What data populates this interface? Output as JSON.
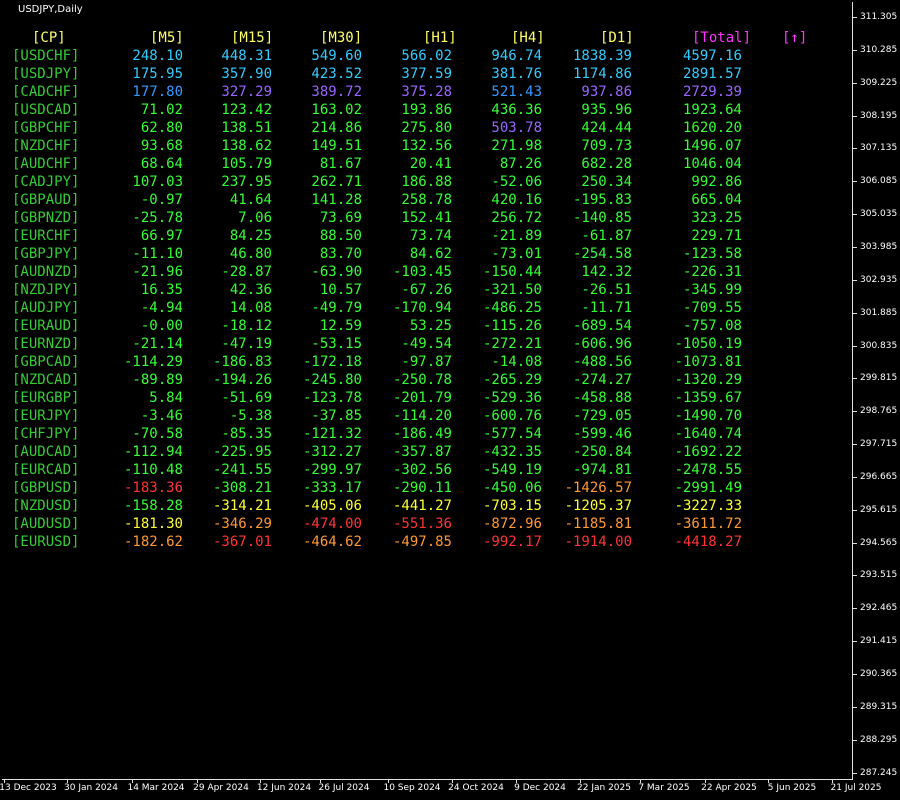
{
  "window": {
    "title": "USDJPY,Daily"
  },
  "price_axis": [
    "311.305",
    "310.285",
    "309.225",
    "308.195",
    "307.135",
    "306.085",
    "305.035",
    "303.985",
    "302.935",
    "301.885",
    "300.835",
    "299.815",
    "298.765",
    "297.715",
    "296.665",
    "295.615",
    "294.565",
    "293.515",
    "292.465",
    "291.415",
    "290.365",
    "289.315",
    "288.295",
    "287.245"
  ],
  "date_axis": [
    "13 Dec 2023",
    "30 Jan 2024",
    "14 Mar 2024",
    "29 Apr 2024",
    "12 Jun 2024",
    "26 Jul 2024",
    "10 Sep 2024",
    "24 Oct 2024",
    "9 Dec 2024",
    "22 Jan 2025",
    "7 Mar 2025",
    "22 Apr 2025",
    "5 Jun 2025",
    "21 Jul 2025"
  ],
  "colors": {
    "background": "#000000",
    "header_yellow": "#FFFF66",
    "header_magenta": "#FF33FF",
    "pair_green": "#32CD32",
    "cyan": "#33CCFF",
    "blue": "#3399FF",
    "purple": "#9966FF",
    "green": "#33FF33",
    "yellow": "#FFFF33",
    "orange": "#FF9933",
    "red": "#FF3333"
  },
  "table": {
    "headers": [
      "[CP]",
      "[M5]",
      "[M15]",
      "[M30]",
      "[H1]",
      "[H4]",
      "[D1]",
      "[Total]",
      "[↑]"
    ],
    "rows": [
      {
        "pair": "[USDCHF]",
        "values": [
          "248.10",
          "448.31",
          "549.60",
          "566.02",
          "946.74",
          "1838.39",
          "4597.16"
        ],
        "colors": [
          "cyan",
          "cyan",
          "cyan",
          "cyan",
          "cyan",
          "cyan",
          "cyan"
        ]
      },
      {
        "pair": "[USDJPY]",
        "values": [
          "175.95",
          "357.90",
          "423.52",
          "377.59",
          "381.76",
          "1174.86",
          "2891.57"
        ],
        "colors": [
          "cyan",
          "cyan",
          "cyan",
          "cyan",
          "cyan",
          "cyan",
          "cyan"
        ]
      },
      {
        "pair": "[CADCHF]",
        "values": [
          "177.80",
          "327.29",
          "389.72",
          "375.28",
          "521.43",
          "937.86",
          "2729.39"
        ],
        "colors": [
          "blue",
          "purple",
          "purple",
          "purple",
          "blue",
          "purple",
          "purple"
        ]
      },
      {
        "pair": "[USDCAD]",
        "values": [
          "71.02",
          "123.42",
          "163.02",
          "193.86",
          "436.36",
          "935.96",
          "1923.64"
        ],
        "colors": [
          "green",
          "green",
          "green",
          "green",
          "green",
          "green",
          "green"
        ]
      },
      {
        "pair": "[GBPCHF]",
        "values": [
          "62.80",
          "138.51",
          "214.86",
          "275.80",
          "503.78",
          "424.44",
          "1620.20"
        ],
        "colors": [
          "green",
          "green",
          "green",
          "green",
          "purple",
          "green",
          "green"
        ]
      },
      {
        "pair": "[NZDCHF]",
        "values": [
          "93.68",
          "138.62",
          "149.51",
          "132.56",
          "271.98",
          "709.73",
          "1496.07"
        ],
        "colors": [
          "green",
          "green",
          "green",
          "green",
          "green",
          "green",
          "green"
        ]
      },
      {
        "pair": "[AUDCHF]",
        "values": [
          "68.64",
          "105.79",
          "81.67",
          "20.41",
          "87.26",
          "682.28",
          "1046.04"
        ],
        "colors": [
          "green",
          "green",
          "green",
          "green",
          "green",
          "green",
          "green"
        ]
      },
      {
        "pair": "[CADJPY]",
        "values": [
          "107.03",
          "237.95",
          "262.71",
          "186.88",
          "-52.06",
          "250.34",
          "992.86"
        ],
        "colors": [
          "green",
          "green",
          "green",
          "green",
          "green",
          "green",
          "green"
        ]
      },
      {
        "pair": "[GBPAUD]",
        "values": [
          "-0.97",
          "41.64",
          "141.28",
          "258.78",
          "420.16",
          "-195.83",
          "665.04"
        ],
        "colors": [
          "green",
          "green",
          "green",
          "green",
          "green",
          "green",
          "green"
        ]
      },
      {
        "pair": "[GBPNZD]",
        "values": [
          "-25.78",
          "7.06",
          "73.69",
          "152.41",
          "256.72",
          "-140.85",
          "323.25"
        ],
        "colors": [
          "green",
          "green",
          "green",
          "green",
          "green",
          "green",
          "green"
        ]
      },
      {
        "pair": "[EURCHF]",
        "values": [
          "66.97",
          "84.25",
          "88.50",
          "73.74",
          "-21.89",
          "-61.87",
          "229.71"
        ],
        "colors": [
          "green",
          "green",
          "green",
          "green",
          "green",
          "green",
          "green"
        ]
      },
      {
        "pair": "[GBPJPY]",
        "values": [
          "-11.10",
          "46.80",
          "83.70",
          "84.62",
          "-73.01",
          "-254.58",
          "-123.58"
        ],
        "colors": [
          "green",
          "green",
          "green",
          "green",
          "green",
          "green",
          "green"
        ]
      },
      {
        "pair": "[AUDNZD]",
        "values": [
          "-21.96",
          "-28.87",
          "-63.90",
          "-103.45",
          "-150.44",
          "142.32",
          "-226.31"
        ],
        "colors": [
          "green",
          "green",
          "green",
          "green",
          "green",
          "green",
          "green"
        ]
      },
      {
        "pair": "[NZDJPY]",
        "values": [
          "16.35",
          "42.36",
          "10.57",
          "-67.26",
          "-321.50",
          "-26.51",
          "-345.99"
        ],
        "colors": [
          "green",
          "green",
          "green",
          "green",
          "green",
          "green",
          "green"
        ]
      },
      {
        "pair": "[AUDJPY]",
        "values": [
          "-4.94",
          "14.08",
          "-49.79",
          "-170.94",
          "-486.25",
          "-11.71",
          "-709.55"
        ],
        "colors": [
          "green",
          "green",
          "green",
          "green",
          "green",
          "green",
          "green"
        ]
      },
      {
        "pair": "[EURAUD]",
        "values": [
          "-0.00",
          "-18.12",
          "12.59",
          "53.25",
          "-115.26",
          "-689.54",
          "-757.08"
        ],
        "colors": [
          "green",
          "green",
          "green",
          "green",
          "green",
          "green",
          "green"
        ]
      },
      {
        "pair": "[EURNZD]",
        "values": [
          "-21.14",
          "-47.19",
          "-53.15",
          "-49.54",
          "-272.21",
          "-606.96",
          "-1050.19"
        ],
        "colors": [
          "green",
          "green",
          "green",
          "green",
          "green",
          "green",
          "green"
        ]
      },
      {
        "pair": "[GBPCAD]",
        "values": [
          "-114.29",
          "-186.83",
          "-172.18",
          "-97.87",
          "-14.08",
          "-488.56",
          "-1073.81"
        ],
        "colors": [
          "green",
          "green",
          "green",
          "green",
          "green",
          "green",
          "green"
        ]
      },
      {
        "pair": "[NZDCAD]",
        "values": [
          "-89.89",
          "-194.26",
          "-245.80",
          "-250.78",
          "-265.29",
          "-274.27",
          "-1320.29"
        ],
        "colors": [
          "green",
          "green",
          "green",
          "green",
          "green",
          "green",
          "green"
        ]
      },
      {
        "pair": "[EURGBP]",
        "values": [
          "5.84",
          "-51.69",
          "-123.78",
          "-201.79",
          "-529.36",
          "-458.88",
          "-1359.67"
        ],
        "colors": [
          "green",
          "green",
          "green",
          "green",
          "green",
          "green",
          "green"
        ]
      },
      {
        "pair": "[EURJPY]",
        "values": [
          "-3.46",
          "-5.38",
          "-37.85",
          "-114.20",
          "-600.76",
          "-729.05",
          "-1490.70"
        ],
        "colors": [
          "green",
          "green",
          "green",
          "green",
          "green",
          "green",
          "green"
        ]
      },
      {
        "pair": "[CHFJPY]",
        "values": [
          "-70.58",
          "-85.35",
          "-121.32",
          "-186.49",
          "-577.54",
          "-599.46",
          "-1640.74"
        ],
        "colors": [
          "green",
          "green",
          "green",
          "green",
          "green",
          "green",
          "green"
        ]
      },
      {
        "pair": "[AUDCAD]",
        "values": [
          "-112.94",
          "-225.95",
          "-312.27",
          "-357.87",
          "-432.35",
          "-250.84",
          "-1692.22"
        ],
        "colors": [
          "green",
          "green",
          "green",
          "green",
          "green",
          "green",
          "green"
        ]
      },
      {
        "pair": "[EURCAD]",
        "values": [
          "-110.48",
          "-241.55",
          "-299.97",
          "-302.56",
          "-549.19",
          "-974.81",
          "-2478.55"
        ],
        "colors": [
          "green",
          "green",
          "green",
          "green",
          "green",
          "green",
          "green"
        ]
      },
      {
        "pair": "[GBPUSD]",
        "values": [
          "-183.36",
          "-308.21",
          "-333.17",
          "-290.11",
          "-450.06",
          "-1426.57",
          "-2991.49"
        ],
        "colors": [
          "red",
          "green",
          "green",
          "green",
          "green",
          "orange",
          "green"
        ]
      },
      {
        "pair": "[NZDUSD]",
        "values": [
          "-158.28",
          "-314.21",
          "-405.06",
          "-441.27",
          "-703.15",
          "-1205.37",
          "-3227.33"
        ],
        "colors": [
          "green",
          "yellow",
          "yellow",
          "yellow",
          "yellow",
          "yellow",
          "yellow"
        ]
      },
      {
        "pair": "[AUDUSD]",
        "values": [
          "-181.30",
          "-346.29",
          "-474.00",
          "-551.36",
          "-872.96",
          "-1185.81",
          "-3611.72"
        ],
        "colors": [
          "yellow",
          "orange",
          "red",
          "red",
          "orange",
          "orange",
          "orange"
        ]
      },
      {
        "pair": "[EURUSD]",
        "values": [
          "-182.62",
          "-367.01",
          "-464.62",
          "-497.85",
          "-992.17",
          "-1914.00",
          "-4418.27"
        ],
        "colors": [
          "orange",
          "red",
          "orange",
          "orange",
          "red",
          "red",
          "red"
        ]
      }
    ]
  }
}
